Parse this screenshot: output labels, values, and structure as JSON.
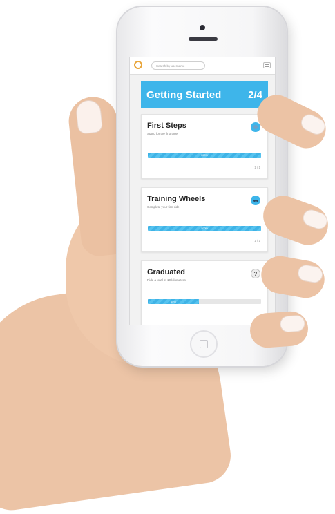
{
  "search": {
    "placeholder": "Search by username"
  },
  "header": {
    "title": "Getting Started",
    "progress": "2/4"
  },
  "cards": [
    {
      "title": "First Steps",
      "description": "Stand for the first time",
      "progress_label": "100%",
      "progress_fraction": 1.0,
      "count": "1 / 1",
      "badge_state": "complete"
    },
    {
      "title": "Training Wheels",
      "description": "Complete your first ride",
      "progress_label": "100%",
      "progress_fraction": 1.0,
      "count": "1 / 1",
      "badge_state": "complete"
    },
    {
      "title": "Graduated",
      "description": "Ride a total of 10 kilometers",
      "progress_label": "45%",
      "progress_fraction": 0.45,
      "badge_symbol": "?",
      "badge_state": "locked"
    }
  ],
  "colors": {
    "accent": "#3eb5ea",
    "logo": "#e8a53a"
  }
}
